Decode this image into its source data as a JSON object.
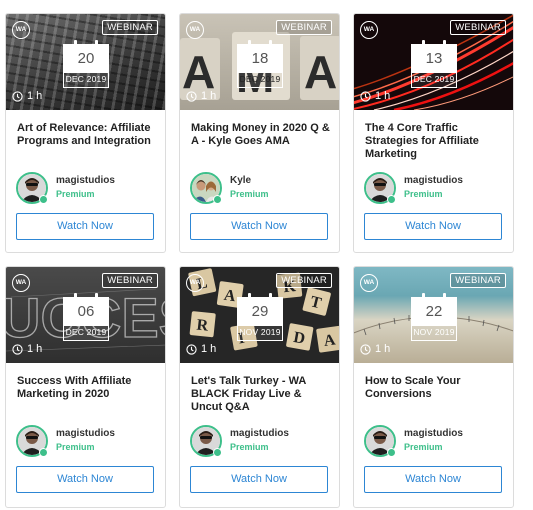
{
  "cards": [
    {
      "badge": "WEBINAR",
      "logo": "WA",
      "day": "20",
      "month": "DEC 2019",
      "duration": "1 h",
      "title": "Art of Relevance: Affiliate Programs and Integration",
      "author": "magistudios",
      "tier": "Premium",
      "button": "Watch Now",
      "thumb_icon": "keyboard-photo"
    },
    {
      "badge": "WEBINAR",
      "logo": "WA",
      "day": "18",
      "month": "DEC 2019",
      "duration": "1 h",
      "title": "Making Money in 2020 Q & A - Kyle Goes AMA",
      "author": "Kyle",
      "tier": "Premium",
      "button": "Watch Now",
      "thumb_icon": "ama-letters-photo"
    },
    {
      "badge": "WEBINAR",
      "logo": "WA",
      "day": "13",
      "month": "DEC 2019",
      "duration": "1 h",
      "title": "The 4 Core Traffic Strategies for Affiliate Marketing",
      "author": "magistudios",
      "tier": "Premium",
      "button": "Watch Now",
      "thumb_icon": "traffic-lights-photo"
    },
    {
      "badge": "WEBINAR",
      "logo": "WA",
      "day": "06",
      "month": "DEC 2019",
      "duration": "1 h",
      "title": "Success With Affiliate Marketing in 2020",
      "author": "magistudios",
      "tier": "Premium",
      "button": "Watch Now",
      "thumb_icon": "chalk-success-photo"
    },
    {
      "badge": "WEBINAR",
      "logo": "WA",
      "day": "29",
      "month": "NOV 2019",
      "duration": "1 h",
      "title": "Let's Talk Turkey - WA BLACK Friday Live & Uncut Q&A",
      "author": "magistudios",
      "tier": "Premium",
      "button": "Watch Now",
      "thumb_icon": "scrabble-tiles-photo"
    },
    {
      "badge": "WEBINAR",
      "logo": "WA",
      "day": "22",
      "month": "NOV 2019",
      "duration": "1 h",
      "title": "How to Scale Your Conversions",
      "author": "magistudios",
      "tier": "Premium",
      "button": "Watch Now",
      "thumb_icon": "weighing-scale-photo"
    }
  ],
  "colors": {
    "accent": "#2d86d4",
    "premium": "#3dbf8a",
    "border": "#dcdcdc"
  }
}
